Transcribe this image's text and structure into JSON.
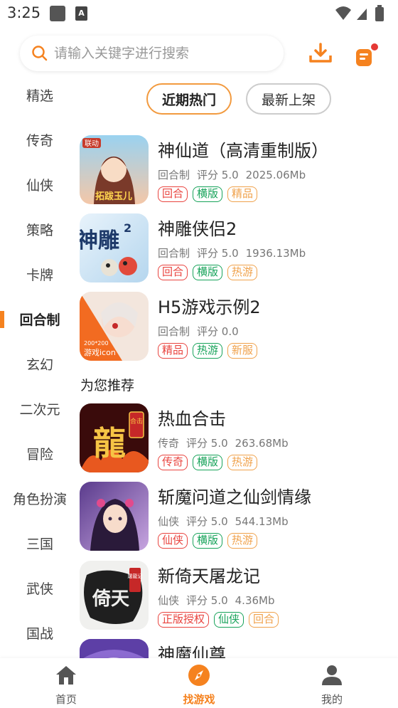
{
  "status_bar": {
    "time": "3:25",
    "app_icon_2": "A"
  },
  "search": {
    "placeholder": "请输入关键字进行搜索"
  },
  "categories": [
    {
      "label": "精选"
    },
    {
      "label": "传奇"
    },
    {
      "label": "仙侠"
    },
    {
      "label": "策略"
    },
    {
      "label": "卡牌"
    },
    {
      "label": "回合制"
    },
    {
      "label": "玄幻"
    },
    {
      "label": "二次元"
    },
    {
      "label": "冒险"
    },
    {
      "label": "角色扮演"
    },
    {
      "label": "三国"
    },
    {
      "label": "武侠"
    },
    {
      "label": "国战"
    }
  ],
  "active_category": "回合制",
  "tabs": [
    {
      "label": "近期热门"
    },
    {
      "label": "最新上架"
    }
  ],
  "games": [
    {
      "name": "神仙道（高清重制版）",
      "category": "回合制",
      "rating": "评分 5.0",
      "size": "2025.06Mb",
      "tags": [
        "回合",
        "横版",
        "精品"
      ],
      "icon_text": "联动",
      "icon_text2": "拓跋玉儿"
    },
    {
      "name": "神雕侠侣2",
      "category": "回合制",
      "rating": "评分 5.0",
      "size": "1936.13Mb",
      "tags": [
        "回合",
        "横版",
        "热游"
      ],
      "icon_text": "神雕",
      "icon_text2": "2"
    },
    {
      "name": "H5游戏示例2",
      "category": "回合制",
      "rating": "评分 0.0",
      "size": "",
      "tags": [
        "精品",
        "热游",
        "新服"
      ],
      "icon_text": "200*200",
      "icon_text2": "游戏icon"
    }
  ],
  "recommend_title": "为您推荐",
  "recommended": [
    {
      "name": "热血合击",
      "category": "传奇",
      "rating": "评分 5.0",
      "size": "263.68Mb",
      "tags": [
        "传奇",
        "横版",
        "热游"
      ],
      "icon_text": "龍",
      "icon_text2": "合击"
    },
    {
      "name": "斩魔问道之仙剑情缘",
      "category": "仙侠",
      "rating": "评分 5.0",
      "size": "544.13Mb",
      "tags": [
        "仙侠",
        "横版",
        "热游"
      ]
    },
    {
      "name": "新倚天屠龙记",
      "category": "仙侠",
      "rating": "评分 5.0",
      "size": "4.36Mb",
      "tags": [
        "正版授权",
        "仙侠",
        "回合"
      ],
      "icon_text": "倚天",
      "icon_text2": "屠龍记"
    },
    {
      "name": "神魔仙尊"
    }
  ],
  "bottom_nav": [
    {
      "label": "首页",
      "icon": "home-icon"
    },
    {
      "label": "找游戏",
      "icon": "compass-icon"
    },
    {
      "label": "我的",
      "icon": "user-icon"
    }
  ],
  "colors": {
    "accent": "#f5821f",
    "tag_red": "#e9443f",
    "tag_green": "#17a35a",
    "tag_orange": "#f0a24c"
  }
}
